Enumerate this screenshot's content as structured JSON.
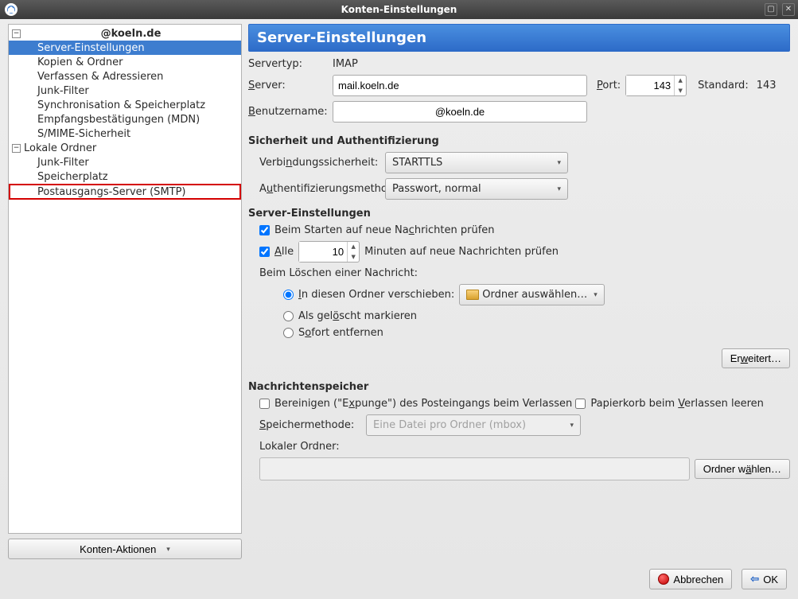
{
  "window": {
    "title": "Konten-Einstellungen"
  },
  "sidebar": {
    "account": "@koeln.de",
    "items": [
      "Server-Einstellungen",
      "Kopien & Ordner",
      "Verfassen & Adressieren",
      "Junk-Filter",
      "Synchronisation & Speicherplatz",
      "Empfangsbestätigungen (MDN)",
      "S/MIME-Sicherheit"
    ],
    "local_label": "Lokale Ordner",
    "local_items": [
      "Junk-Filter",
      "Speicherplatz"
    ],
    "smtp": "Postausgangs-Server (SMTP)",
    "actions_btn": "Konten-Aktionen"
  },
  "main": {
    "title": "Server-Einstellungen",
    "servertype_label": "Servertyp:",
    "servertype_value": "IMAP",
    "server_label": "Server:",
    "server_value": "mail.koeln.de",
    "port_label": "Port:",
    "port_value": "143",
    "standard_label": "Standard:",
    "standard_value": "143",
    "username_label": "Benutzername:",
    "username_value": "@koeln.de",
    "security_title": "Sicherheit und Authentifizierung",
    "connsec_label": "Verbindungssicherheit:",
    "connsec_value": "STARTTLS",
    "authmethod_label": "Authentifizierungsmethode:",
    "authmethod_value": "Passwort, normal",
    "settings_title": "Server-Einstellungen",
    "check_start": "Beim Starten auf neue Nachrichten prüfen",
    "all_label": "Alle",
    "interval_value": "10",
    "minutes_label": "Minuten auf neue Nachrichten prüfen",
    "on_delete_label": "Beim Löschen einer Nachricht:",
    "move_folder": "In diesen Ordner verschieben:",
    "folder_select": "Ordner auswählen…",
    "mark_deleted": "Als gelöscht markieren",
    "remove_now": "Sofort entfernen",
    "advanced_btn": "Erweitert…",
    "storage_title": "Nachrichtenspeicher",
    "expunge": "Bereinigen (\"Expunge\") des Posteingangs beim Verlassen",
    "empty_trash": "Papierkorb beim Verlassen leeren",
    "storemethod_label": "Speichermethode:",
    "storemethod_value": "Eine Datei pro Ordner (mbox)",
    "local_folder_label": "Lokaler Ordner:",
    "choose_folder_btn": "Ordner wählen…"
  },
  "footer": {
    "cancel": "Abbrechen",
    "ok": "OK"
  }
}
